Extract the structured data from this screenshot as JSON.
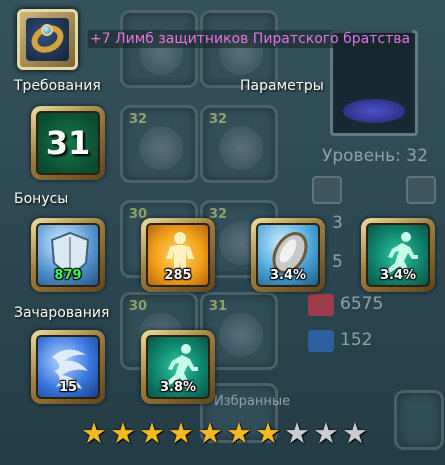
{
  "item": {
    "title": "+7 Лимб защитников Пиратского братства",
    "icon": "gold-ring-blue-gem-icon"
  },
  "sections": {
    "requirements": "Требования",
    "parameters": "Параметры",
    "bonuses": "Бонусы",
    "enchantments": "Зачарования"
  },
  "requirement_level": "31",
  "bonuses": [
    {
      "icon": "shield-icon",
      "value": "879",
      "color": "#35ff52"
    },
    {
      "icon": "figure-icon",
      "value": "285"
    },
    {
      "icon": "oval-shield-icon",
      "value": "3.4%"
    },
    {
      "icon": "running-man-icon",
      "value": "3.4%"
    }
  ],
  "enchantments": [
    {
      "icon": "swirl-icon",
      "value": "15"
    },
    {
      "icon": "running-man-icon",
      "value": "3.8%"
    }
  ],
  "rating": {
    "filled": 7,
    "total": 10
  },
  "background": {
    "level_label": "Уровень: 32",
    "stat_1": "6575",
    "stat_2": "152",
    "slot_levels": [
      "32",
      "32",
      "30",
      "32",
      "31"
    ],
    "partial_3": "3",
    "partial_5": "5",
    "bottom_text": "Избранные"
  }
}
